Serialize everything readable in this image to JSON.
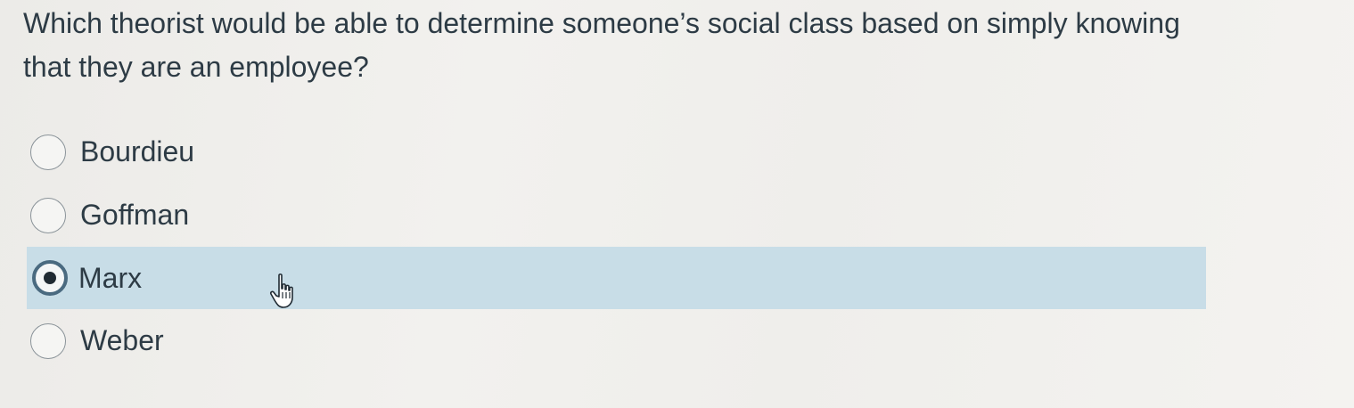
{
  "question": {
    "text": "Which theorist would be able to determine someone’s social class based on simply knowing that they are an employee?"
  },
  "answers": [
    {
      "label": "Bourdieu",
      "selected": false
    },
    {
      "label": "Goffman",
      "selected": false
    },
    {
      "label": "Marx",
      "selected": true
    },
    {
      "label": "Weber",
      "selected": false
    }
  ],
  "colors": {
    "selected_row": "#c8dde7",
    "selected_ring": "#4a6a80",
    "text": "#2d3b45"
  },
  "cursor": {
    "icon": "hand-pointer-icon"
  }
}
